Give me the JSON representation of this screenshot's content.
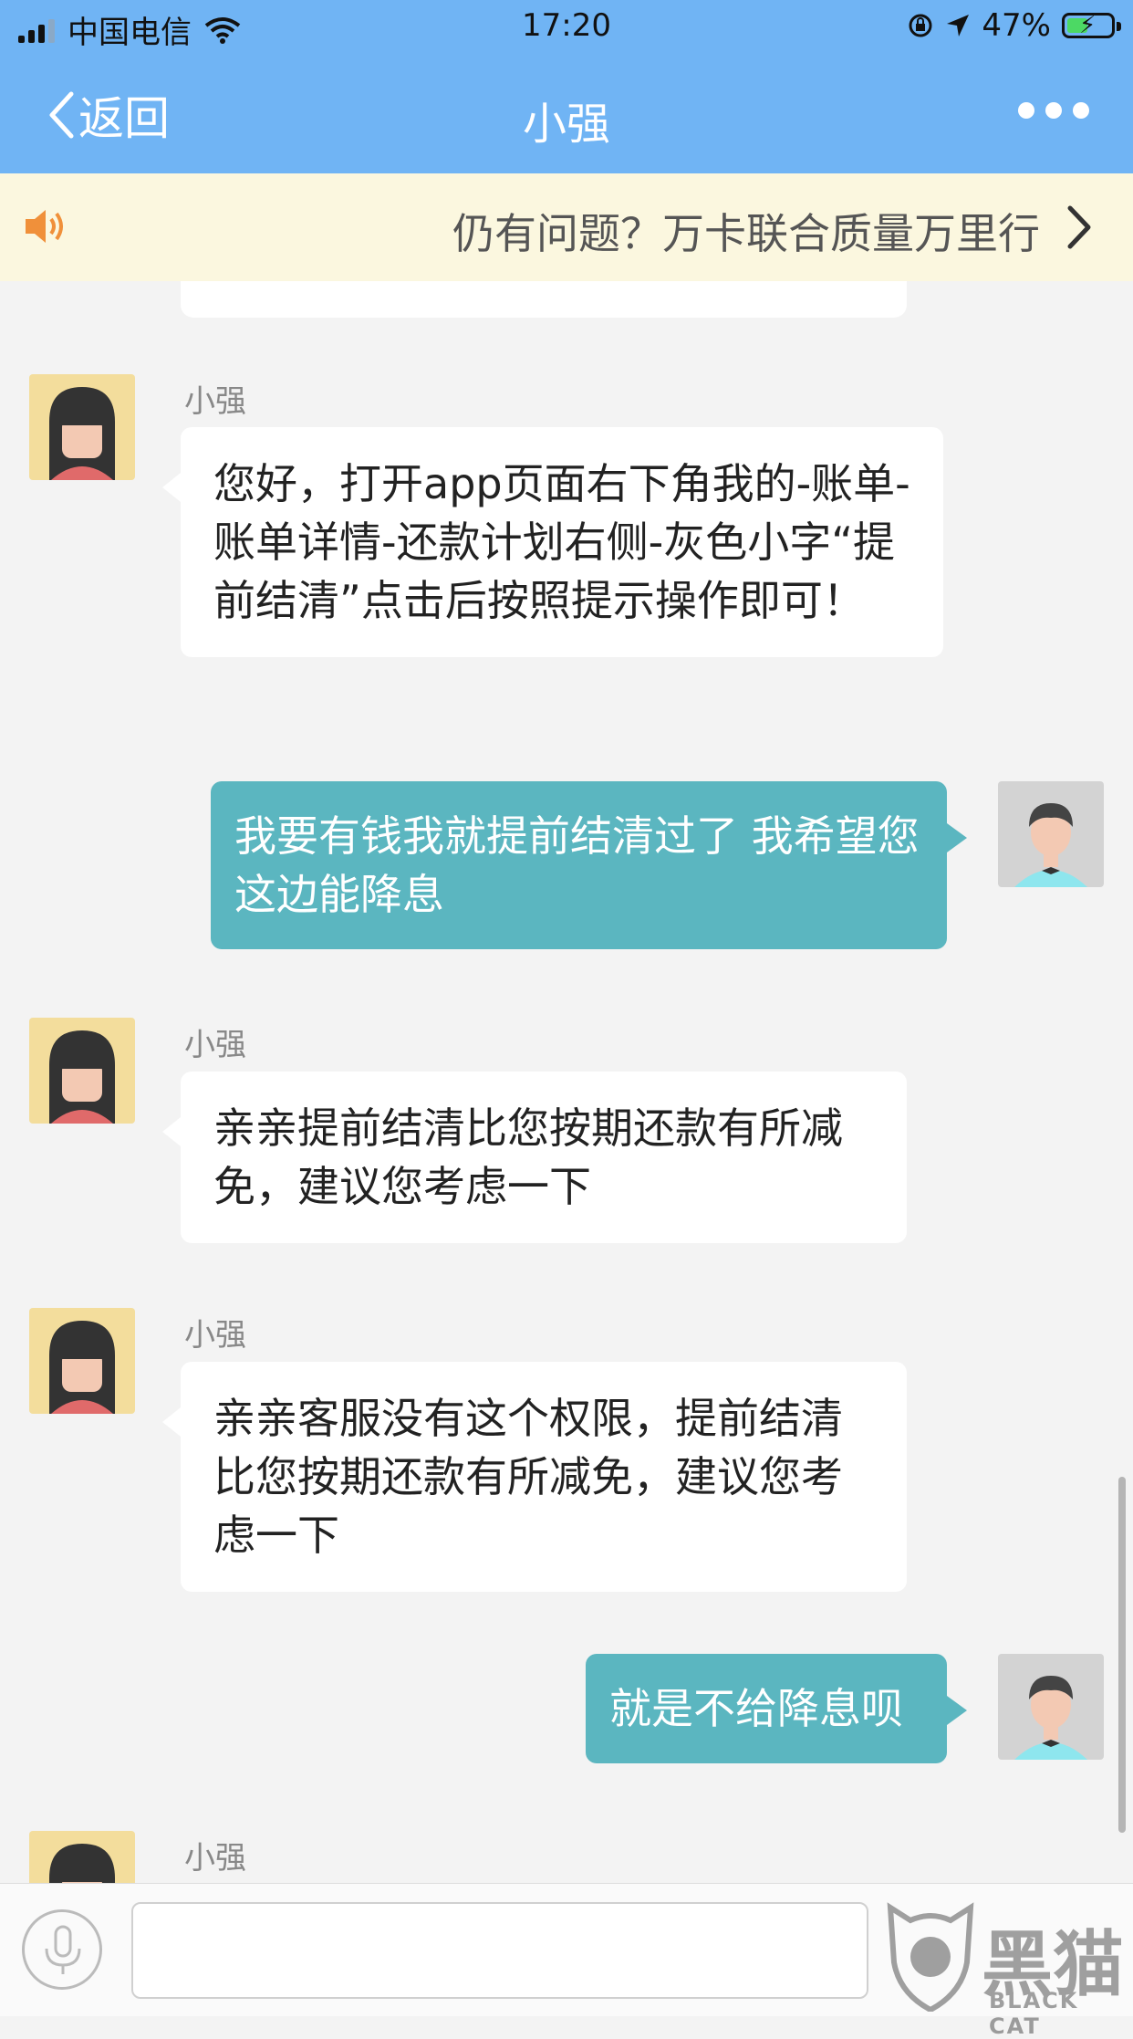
{
  "status_bar": {
    "carrier": "中国电信",
    "time": "17:20",
    "battery": "47%",
    "battery_level": 0.47,
    "icons": [
      "signal-icon",
      "wifi-icon",
      "rotation-lock-icon",
      "location-icon",
      "battery-icon"
    ]
  },
  "nav": {
    "back_label": "返回",
    "title": "小强",
    "more_icon": "ellipsis-icon"
  },
  "notice": {
    "text": "仍有问题？万卡联合质量万里行",
    "icon": "speaker-icon"
  },
  "messages": [
    {
      "side": "in",
      "sender": "小强",
      "text": "您好，打开app页面右下角我的-账单-账单详情-还款计划右侧-灰色小字“提前结清”点击后按照提示操作即可！"
    },
    {
      "side": "out",
      "text": "我要有钱我就提前结清过了  我希望您这边能降息"
    },
    {
      "side": "in",
      "sender": "小强",
      "text": "亲亲提前结清比您按期还款有所减免，建议您考虑一下"
    },
    {
      "side": "in",
      "sender": "小强",
      "text": "亲亲客服没有这个权限，提前结清比您按期还款有所减免，建议您考虑一下"
    },
    {
      "side": "out",
      "text": "就是不给降息呗"
    },
    {
      "side": "in",
      "sender": "小强",
      "text": ""
    }
  ],
  "input": {
    "placeholder": "",
    "mic_icon": "microphone-icon"
  },
  "watermark": {
    "cn": "黑猫",
    "en": "BLACK CAT"
  },
  "colors": {
    "header": "#70b4f4",
    "outgoing_bubble": "#5bb6c0",
    "incoming_bubble": "#ffffff",
    "notice_bg": "#fbf7df",
    "chat_bg": "#f3f3f3"
  }
}
